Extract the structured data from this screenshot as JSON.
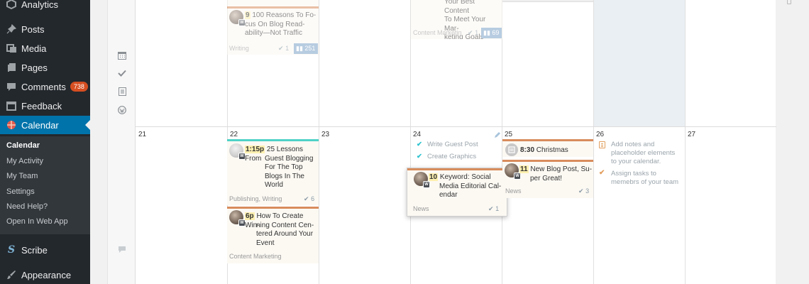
{
  "sidebar": {
    "items": [
      {
        "label": "Analytics",
        "icon": "analytics-icon"
      },
      {
        "label": "Posts",
        "icon": "pin-icon"
      },
      {
        "label": "Media",
        "icon": "media-icon"
      },
      {
        "label": "Pages",
        "icon": "pages-icon"
      },
      {
        "label": "Comments",
        "icon": "comment-icon",
        "badge": "738"
      },
      {
        "label": "Feedback",
        "icon": "feedback-icon"
      },
      {
        "label": "Calendar",
        "icon": "calendar-icon",
        "active": true
      },
      {
        "label": "Scribe",
        "icon": "scribe-icon"
      },
      {
        "label": "Appearance",
        "icon": "brush-icon"
      }
    ],
    "submenu": [
      "Calendar",
      "My Activity",
      "My Team",
      "Settings",
      "Need Help?",
      "Open In Web App"
    ]
  },
  "colors": {
    "sidebar_bg": "#23282d",
    "active_blue": "#0073aa",
    "badge_orange": "#d54e21",
    "stat_blue": "#7da3c8",
    "category_orange": "#d88c5c",
    "category_teal": "#4fd2c6",
    "highlight_yellow": "#fdf0b0",
    "weekend_shade": "#e9eff3"
  },
  "calendar": {
    "week2_days": [
      "21",
      "22",
      "23",
      "24",
      "25",
      "26",
      "27"
    ],
    "week1": {
      "post_a": {
        "time": "9",
        "title": [
          "100 Reasons To Fo-",
          "cus On Blog Read-",
          "ability—Not Traffic"
        ],
        "category": "Writing",
        "checks": "1",
        "views": "251"
      },
      "post_b": {
        "title": [
          "Your Best Content",
          "To Meet Your Mar-",
          "keting Goals"
        ],
        "category": "Content Marketin",
        "checks": "1",
        "views": "69"
      }
    },
    "week2": {
      "post_22a": {
        "time": "1:15p",
        "title": [
          "25 Lessons From",
          "Guest Blogging",
          "For The Top",
          "Blogs In The",
          "World"
        ],
        "category": "Publishing, Writing",
        "checks": "6"
      },
      "post_22b": {
        "time": "6p",
        "title": [
          "How To Create Win-",
          "ning Content Cen-",
          "tered Around Your",
          "Event"
        ],
        "category": "Content Marketing"
      },
      "tasks_24": [
        "Write Guest Post",
        "Create Graphics"
      ],
      "post_24": {
        "time": "10",
        "title": [
          "Keyword: Social",
          "Media Editorial Cal-",
          "endar"
        ],
        "category": "News",
        "checks": "1"
      },
      "event_25": {
        "time": "8:30",
        "title": "Christmas"
      },
      "post_25": {
        "time": "11",
        "title": [
          "New Blog Post, Su-",
          "per Great!"
        ],
        "category": "News",
        "checks": "3"
      },
      "notes_26": [
        {
          "text": [
            "Add notes and",
            "placeholder elements",
            "to your calendar."
          ],
          "icon": "note-icon"
        },
        {
          "text": [
            "Assign tasks to",
            "memebrs of your team"
          ],
          "icon": "check-icon"
        }
      ]
    }
  }
}
